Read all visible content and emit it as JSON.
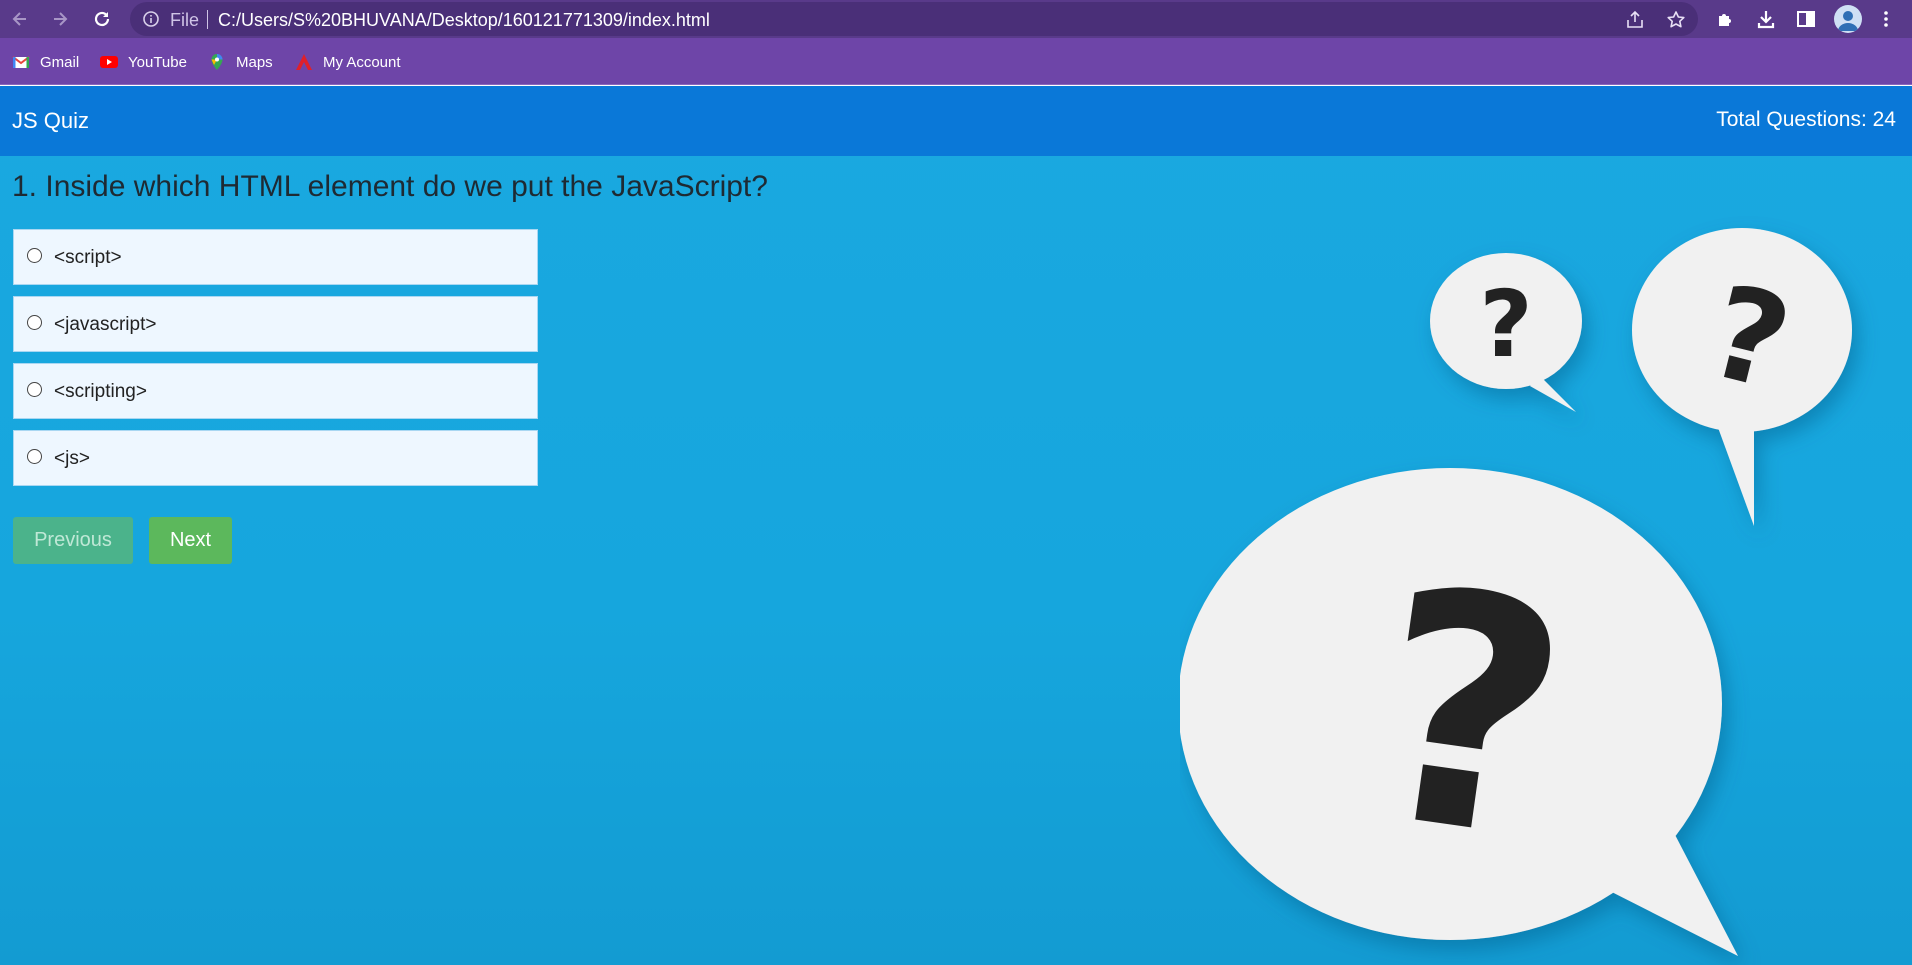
{
  "browser": {
    "url_scheme_label": "File",
    "url": "C:/Users/S%20BHUVANA/Desktop/160121771309/index.html",
    "bookmarks": [
      {
        "label": "Gmail",
        "icon": "gmail-icon"
      },
      {
        "label": "YouTube",
        "icon": "youtube-icon"
      },
      {
        "label": "Maps",
        "icon": "maps-icon"
      },
      {
        "label": "My Account",
        "icon": "account-icon"
      }
    ]
  },
  "header": {
    "title": "JS Quiz",
    "total_questions": "Total Questions: 24"
  },
  "quiz": {
    "question": "1. Inside which HTML element do we put the JavaScript?",
    "options": [
      "<script>",
      "<javascript>",
      "<scripting>",
      "<js>"
    ],
    "prev_label": "Previous",
    "next_label": "Next"
  },
  "illustration": {
    "glyph": "?",
    "bubble_color": "#f1f1f1",
    "mark_color": "#222222"
  },
  "colors": {
    "browser_frame": "#593a8a",
    "bookmarks_bar": "#6e45a8",
    "app_header": "#0a78d8",
    "page_background": "#1aa8e0",
    "next_button": "#5cb85c"
  }
}
